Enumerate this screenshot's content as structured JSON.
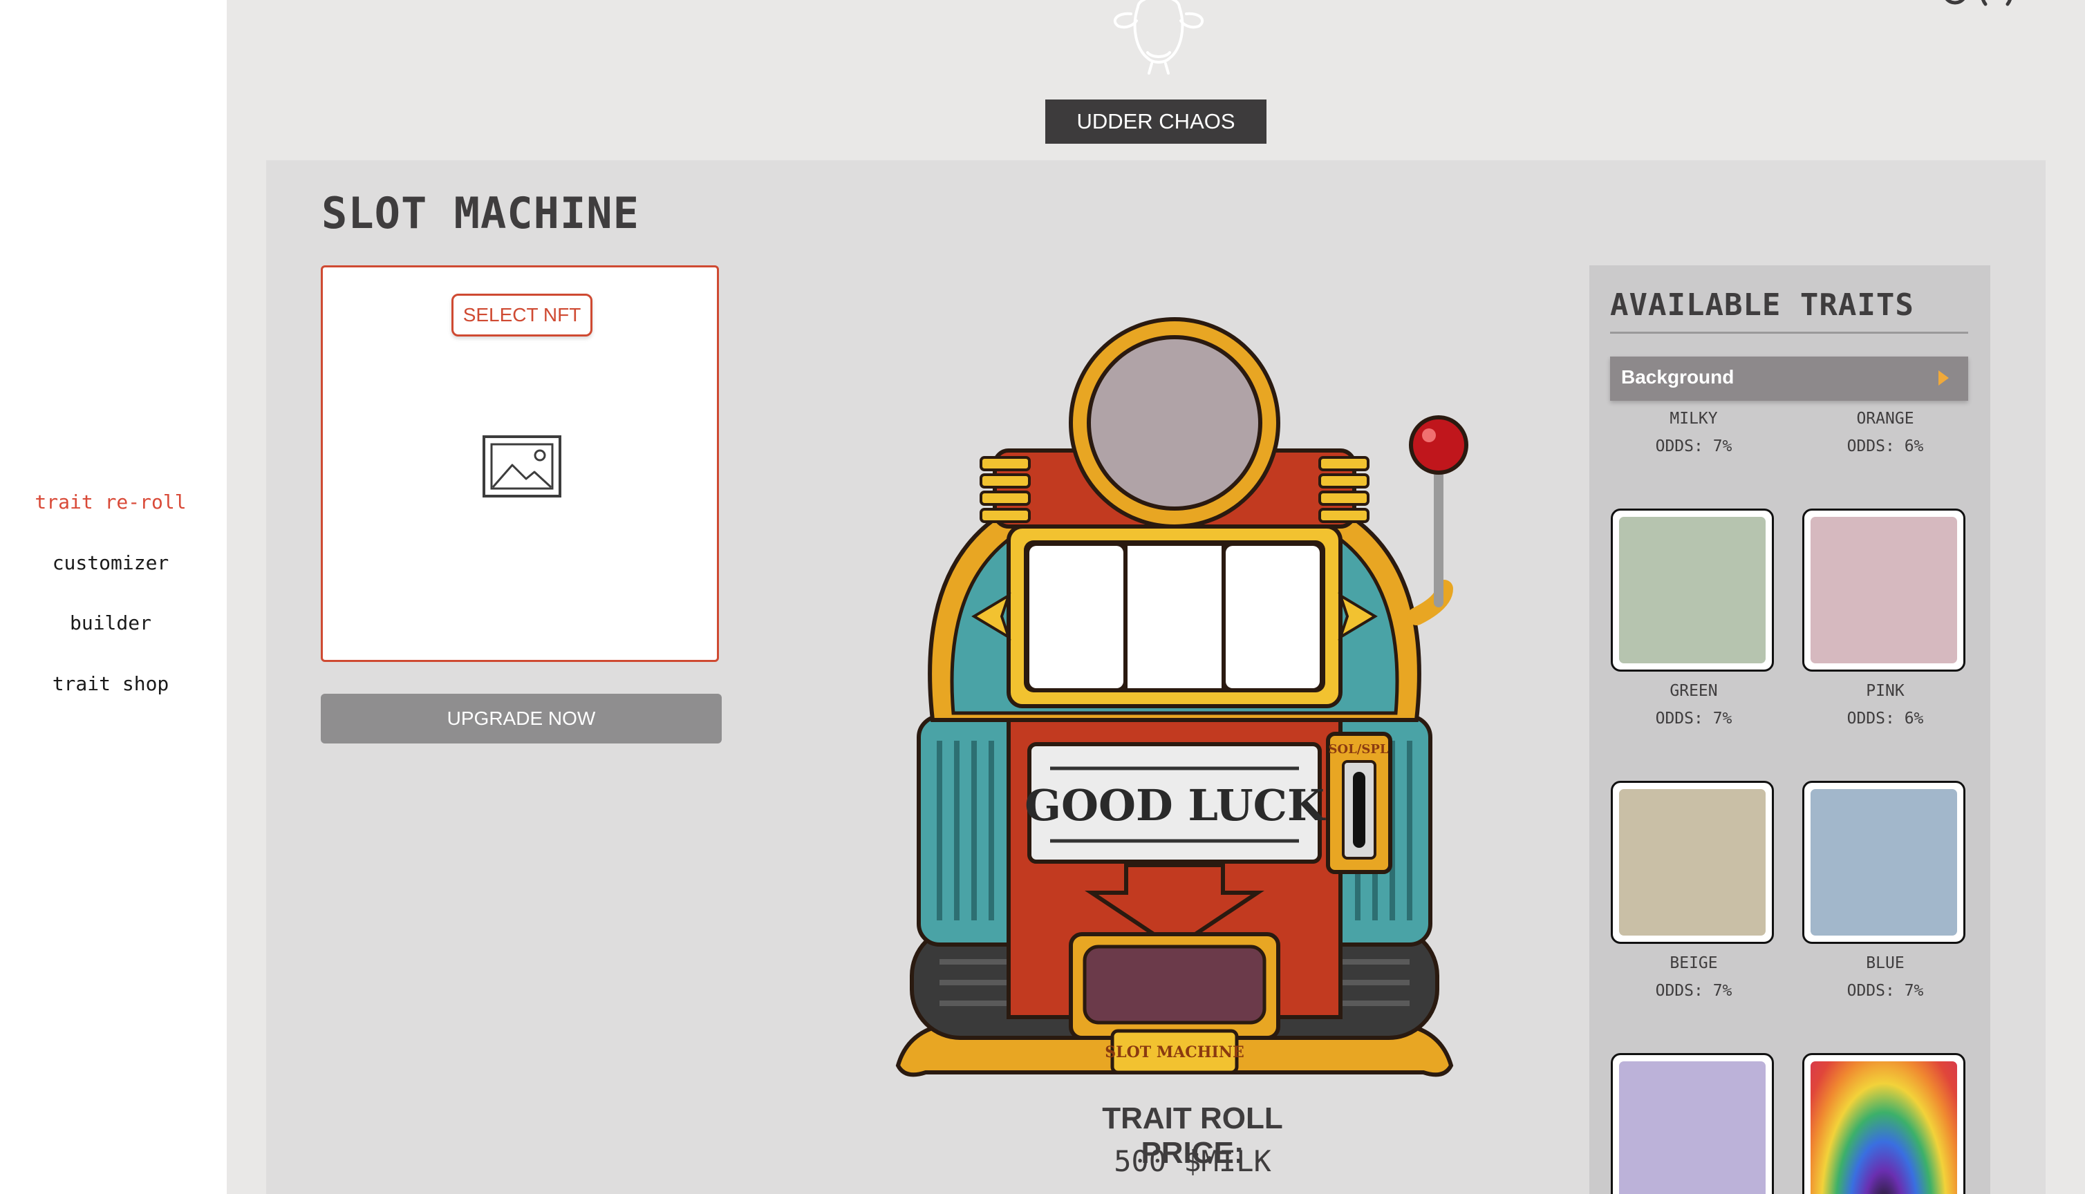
{
  "sidebar": {
    "items": [
      {
        "label": "trait re-roll",
        "active": true
      },
      {
        "label": "customizer",
        "active": false
      },
      {
        "label": "builder",
        "active": false
      },
      {
        "label": "trait shop",
        "active": false
      }
    ]
  },
  "header": {
    "badge_label": "UDDER CHAOS",
    "logo_icon": "cow-logo-icon"
  },
  "page": {
    "title": "SLOT MACHINE"
  },
  "nft_selector": {
    "select_label": "SELECT NFT",
    "placeholder_icon": "image-placeholder-icon",
    "upgrade_label": "UPGRADE NOW"
  },
  "slot_machine": {
    "sign_text": "GOOD LUCK",
    "coin_slot_label": "SOL/SPL",
    "plate_label": "SLOT MACHINE",
    "price_label": "TRAIT ROLL PRICE:",
    "price_value": "500 $MILK"
  },
  "traits": {
    "title": "AVAILABLE TRAITS",
    "category": "Background",
    "items": [
      {
        "name": "MILKY",
        "odds": "ODDS: 7%"
      },
      {
        "name": "ORANGE",
        "odds": "ODDS: 6%"
      },
      {
        "name": "GREEN",
        "odds": "ODDS: 7%",
        "color": "#b6c4af"
      },
      {
        "name": "PINK",
        "odds": "ODDS: 6%",
        "color": "#d6b9bf"
      },
      {
        "name": "BEIGE",
        "odds": "ODDS: 7%",
        "color": "#c9bfa6"
      },
      {
        "name": "BLUE",
        "odds": "ODDS: 7%",
        "color": "#a2b7cb"
      },
      {
        "color": "#bcb2d9"
      },
      {
        "color": "rainbow"
      }
    ]
  },
  "colors": {
    "accent": "#d94a38",
    "dark": "#3d3b3c",
    "panel": "#dedddd"
  }
}
